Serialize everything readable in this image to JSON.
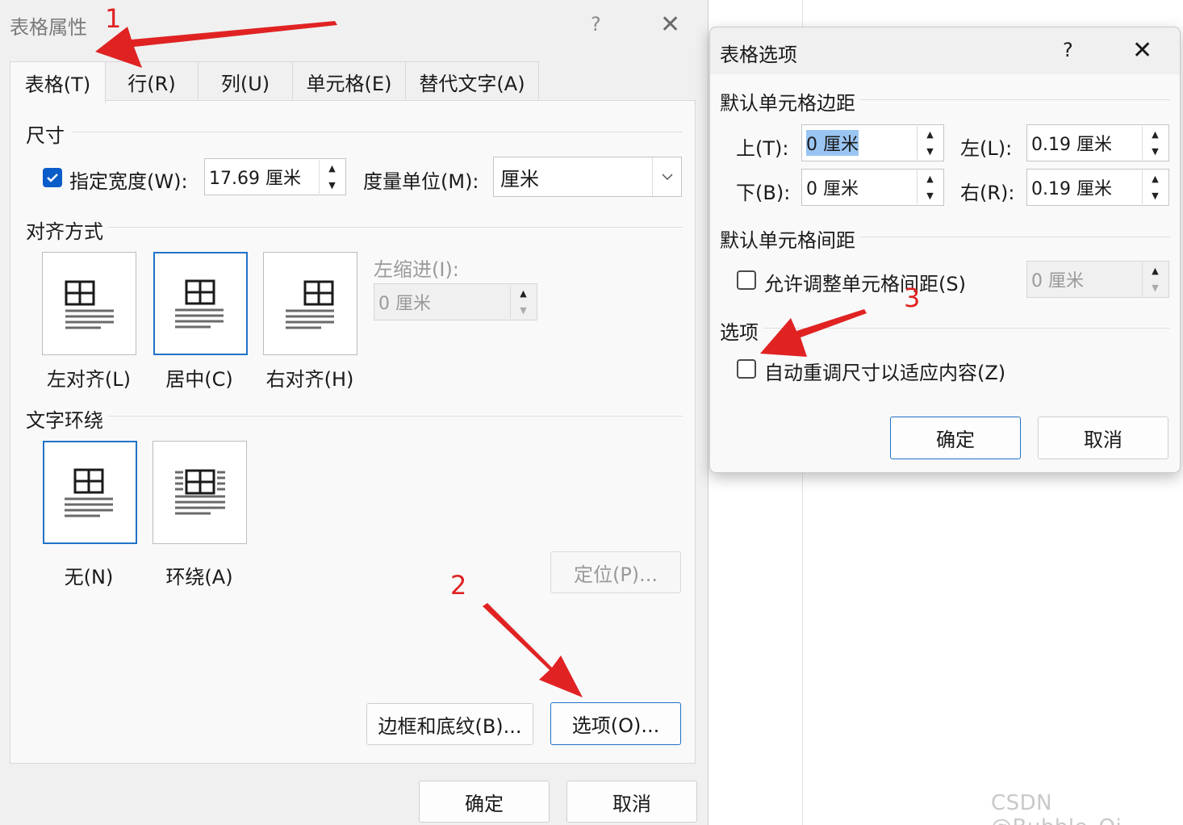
{
  "background": {
    "watermark": "CSDN @Bubble_Qi"
  },
  "table_properties": {
    "title": "表格属性",
    "help": "?",
    "close": "✕",
    "tabs": [
      {
        "label": "表格(T)",
        "active": true
      },
      {
        "label": "行(R)",
        "active": false
      },
      {
        "label": "列(U)",
        "active": false
      },
      {
        "label": "单元格(E)",
        "active": false
      },
      {
        "label": "替代文字(A)",
        "active": false
      }
    ],
    "size": {
      "section": "尺寸",
      "specify_width_checked": true,
      "specify_width_label": "指定宽度(W):",
      "width_value": "17.69 厘米",
      "measure_label": "度量单位(M):",
      "measure_value": "厘米"
    },
    "alignment": {
      "section": "对齐方式",
      "left": "左对齐(L)",
      "center": "居中(C)",
      "right": "右对齐(H)",
      "selected": "center",
      "indent_label": "左缩进(I):",
      "indent_value": "0 厘米"
    },
    "text_wrapping": {
      "section": "文字环绕",
      "none": "无(N)",
      "around": "环绕(A)",
      "selected": "none",
      "positioning_button": "定位(P)..."
    },
    "borders_button": "边框和底纹(B)...",
    "options_button": "选项(O)...",
    "ok": "确定",
    "cancel": "取消"
  },
  "table_options": {
    "title": "表格选项",
    "help": "?",
    "close": "✕",
    "margins_section": "默认单元格边距",
    "top_label": "上(T):",
    "top_value": "0 厘米",
    "bottom_label": "下(B):",
    "bottom_value": "0 厘米",
    "left_label": "左(L):",
    "left_value": "0.19 厘米",
    "right_label": "右(R):",
    "right_value": "0.19 厘米",
    "spacing_section": "默认单元格间距",
    "allow_spacing_label": "允许调整单元格间距(S)",
    "allow_spacing_checked": false,
    "spacing_value": "0 厘米",
    "options_section": "选项",
    "autofit_label": "自动重调尺寸以适应内容(Z)",
    "autofit_checked": false,
    "ok": "确定",
    "cancel": "取消"
  },
  "annotations": {
    "step1": "1",
    "step2": "2",
    "step3": "3",
    "color": "#e02222"
  },
  "colors": {
    "accent": "#0a5cc8",
    "selection": "#9ac5f2",
    "dialog_bg": "#f0f0f0"
  }
}
